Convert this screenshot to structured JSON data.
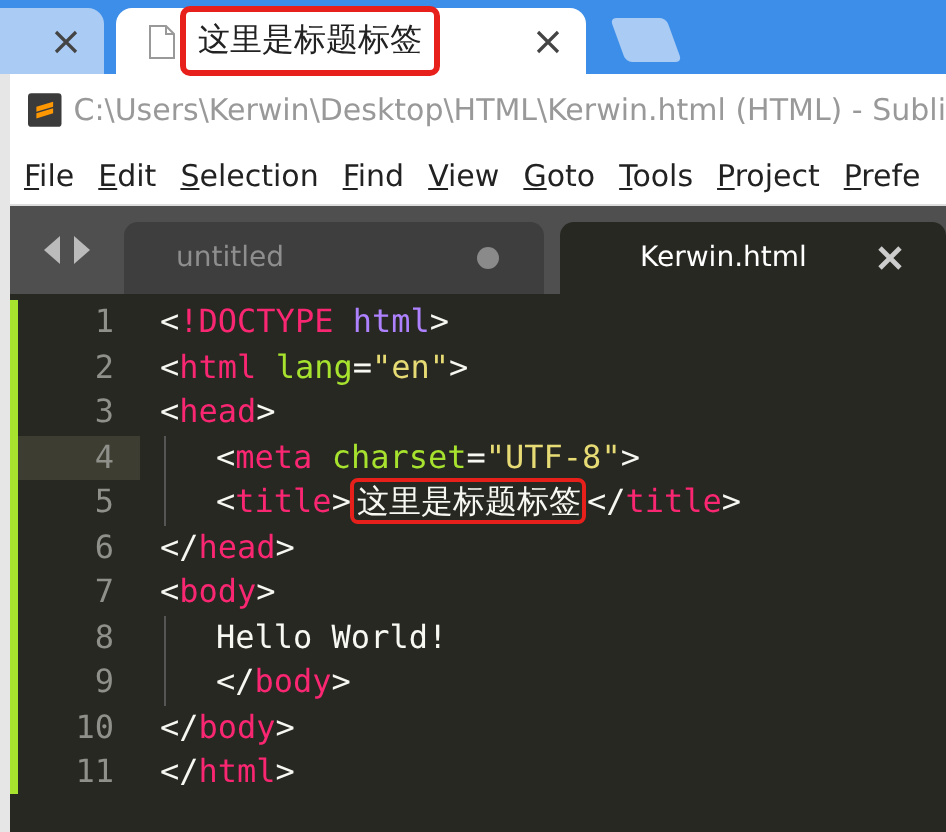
{
  "browser": {
    "tabs": [
      {
        "selected": false
      },
      {
        "title": "这里是标题标签",
        "selected": true,
        "highlighted": true
      }
    ]
  },
  "window": {
    "title": "C:\\Users\\Kerwin\\Desktop\\HTML\\Kerwin.html (HTML) - Subli"
  },
  "menu": [
    "File",
    "Edit",
    "Selection",
    "Find",
    "View",
    "Goto",
    "Tools",
    "Project",
    "Prefe"
  ],
  "editor_tabs": [
    {
      "label": "untitled",
      "selected": false,
      "modified": true
    },
    {
      "label": "Kerwin.html",
      "selected": true,
      "modified": false
    }
  ],
  "lines": [
    {
      "number": "1",
      "current": false,
      "indented": false,
      "tokens": [
        {
          "text": "<",
          "kind": "punct"
        },
        {
          "text": "!DOCTYPE",
          "kind": "tag"
        },
        {
          "text": "html",
          "kind": "keyword"
        },
        {
          "text": ">",
          "kind": "punct"
        }
      ]
    },
    {
      "number": "2",
      "current": false,
      "indented": false,
      "tokens": [
        {
          "text": "<",
          "kind": "punct"
        },
        {
          "text": "html",
          "kind": "tag"
        },
        {
          "text": "lang",
          "kind": "attr"
        },
        {
          "text": "=",
          "kind": "punct"
        },
        {
          "text": "\"en\"",
          "kind": "string"
        },
        {
          "text": ">",
          "kind": "punct"
        }
      ]
    },
    {
      "number": "3",
      "current": false,
      "indented": false,
      "tokens": [
        {
          "text": "<",
          "kind": "punct"
        },
        {
          "text": "head",
          "kind": "tag"
        },
        {
          "text": ">",
          "kind": "punct"
        }
      ]
    },
    {
      "number": "4",
      "current": true,
      "indented": true,
      "tokens": [
        {
          "text": "<",
          "kind": "punct"
        },
        {
          "text": "meta",
          "kind": "tag"
        },
        {
          "text": "charset",
          "kind": "attr"
        },
        {
          "text": "=",
          "kind": "punct"
        },
        {
          "text": "\"UTF-8\"",
          "kind": "string"
        },
        {
          "text": ">",
          "kind": "punct"
        }
      ]
    },
    {
      "number": "5",
      "current": false,
      "indented": true,
      "tokens": [
        {
          "text": "<",
          "kind": "punct"
        },
        {
          "text": "title",
          "kind": "tag"
        },
        {
          "text": ">",
          "kind": "punct"
        },
        {
          "text": "这里是标题标签",
          "kind": "text",
          "highlighted": true
        },
        {
          "text": "</",
          "kind": "punct"
        },
        {
          "text": "title",
          "kind": "tag"
        },
        {
          "text": ">",
          "kind": "punct"
        }
      ]
    },
    {
      "number": "6",
      "current": false,
      "indented": false,
      "tokens": [
        {
          "text": "</",
          "kind": "punct"
        },
        {
          "text": "head",
          "kind": "tag"
        },
        {
          "text": ">",
          "kind": "punct"
        }
      ]
    },
    {
      "number": "7",
      "current": false,
      "indented": false,
      "tokens": [
        {
          "text": "<",
          "kind": "punct"
        },
        {
          "text": "body",
          "kind": "tag"
        },
        {
          "text": ">",
          "kind": "punct"
        }
      ]
    },
    {
      "number": "8",
      "current": false,
      "indented": true,
      "tokens": [
        {
          "text": "Hello World!",
          "kind": "text"
        }
      ]
    },
    {
      "number": "9",
      "current": false,
      "indented": true,
      "tokens": [
        {
          "text": "</",
          "kind": "punct"
        },
        {
          "text": "body",
          "kind": "tag"
        },
        {
          "text": ">",
          "kind": "punct"
        }
      ]
    },
    {
      "number": "10",
      "current": false,
      "indented": false,
      "tokens": [
        {
          "text": "</",
          "kind": "punct"
        },
        {
          "text": "body",
          "kind": "tag"
        },
        {
          "text": ">",
          "kind": "punct"
        }
      ]
    },
    {
      "number": "11",
      "current": false,
      "indented": false,
      "tokens": [
        {
          "text": "</",
          "kind": "punct"
        },
        {
          "text": "html",
          "kind": "tag"
        },
        {
          "text": ">",
          "kind": "punct"
        }
      ]
    }
  ]
}
